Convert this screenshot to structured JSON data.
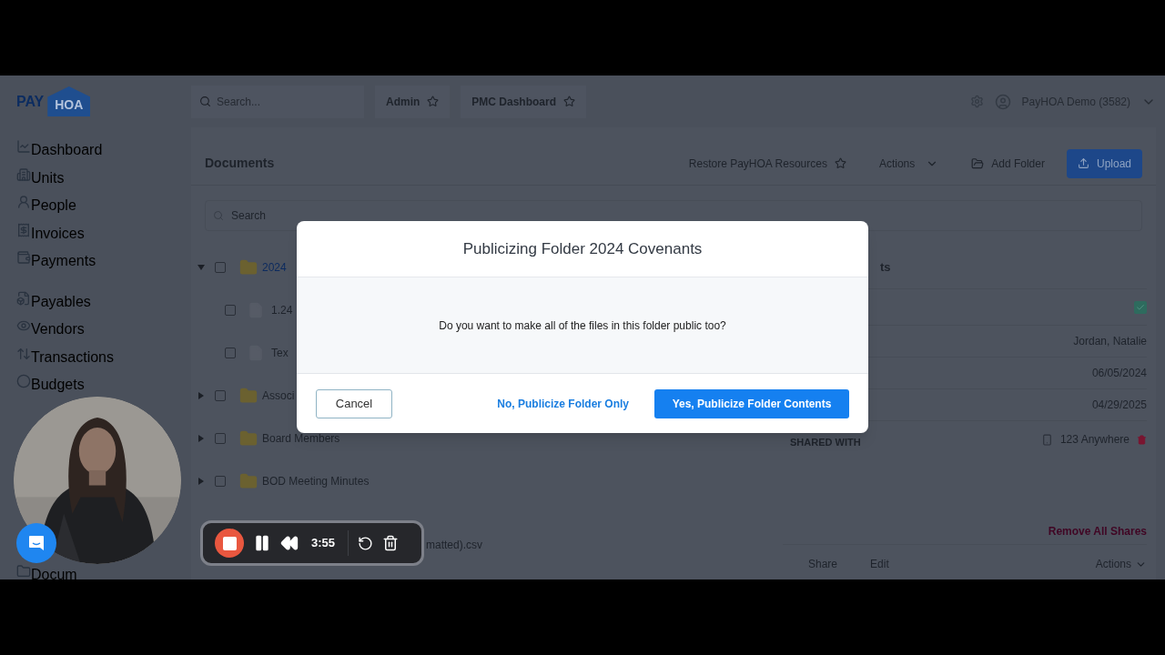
{
  "logo": {
    "word": "PAY",
    "badge": "HOA"
  },
  "topbar": {
    "search": {
      "placeholder": "Search..."
    },
    "favorites": [
      {
        "label": "Admin"
      },
      {
        "label": "PMC Dashboard"
      }
    ],
    "account": "PayHOA Demo (3582)"
  },
  "sidebar": {
    "groups": [
      [
        {
          "label": "Dashboard"
        },
        {
          "label": "Units"
        },
        {
          "label": "People"
        },
        {
          "label": "Invoices"
        },
        {
          "label": "Payments"
        }
      ],
      [
        {
          "label": "Payables"
        },
        {
          "label": "Vendors"
        },
        {
          "label": "Transactions"
        },
        {
          "label": "Budgets"
        }
      ],
      [
        {
          "label": "Docum"
        }
      ]
    ]
  },
  "documents": {
    "title": "Documents",
    "actions": [
      {
        "kind": "favorite",
        "label": "Restore PayHOA Resources"
      },
      {
        "kind": "menu",
        "label": "Actions"
      },
      {
        "kind": "folder",
        "label": "Add Folder"
      },
      {
        "kind": "primary",
        "label": "Upload"
      }
    ],
    "search": {
      "placeholder": "Search"
    },
    "tree": [
      {
        "kind": "folder",
        "label": "2024",
        "expanded": true,
        "link": true,
        "checked": false,
        "children": [
          {
            "kind": "file",
            "label": "1.24",
            "checked": false
          },
          {
            "kind": "file",
            "label": "Tex",
            "checked": false
          }
        ]
      },
      {
        "kind": "folder",
        "label": "Associ",
        "expanded": false,
        "link": false,
        "checked": false
      },
      {
        "kind": "folder",
        "label": "Board Members",
        "expanded": false,
        "link": false,
        "checked": false
      },
      {
        "kind": "folder",
        "label": "BOD Meeting Minutes",
        "expanded": false,
        "link": false,
        "checked": false
      }
    ],
    "partial_file": "matted).csv"
  },
  "details": {
    "header": "ts",
    "public": {
      "checked": true
    },
    "fields": [
      "Jordan, Natalie",
      "06/05/2024",
      "04/29/2025"
    ],
    "shared_with_label": "SHARED WITH",
    "shared_with": [
      "123 Anywhere"
    ],
    "remove_all": "Remove All Shares",
    "footer": [
      "Share",
      "Edit"
    ],
    "footer_menu": "Actions"
  },
  "modal": {
    "title": "Publicizing Folder 2024 Covenants",
    "message": "Do you want to make all of the files in this folder public too?",
    "buttons": [
      {
        "kind": "outline",
        "label": "Cancel"
      },
      {
        "kind": "link",
        "label": "No, Publicize Folder Only"
      },
      {
        "kind": "primary",
        "label": "Yes, Publicize Folder Contents"
      }
    ]
  },
  "recorder": {
    "time": "3:55"
  }
}
